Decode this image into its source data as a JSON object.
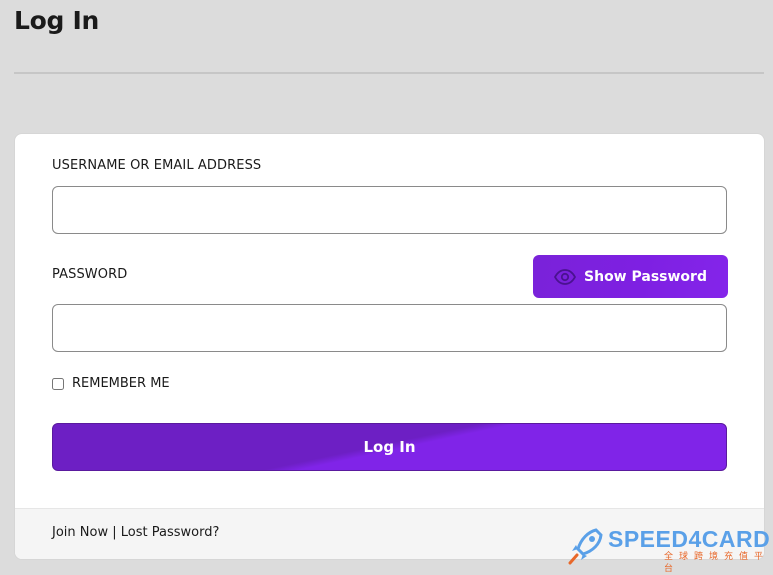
{
  "page": {
    "title": "Log In"
  },
  "form": {
    "username_label": "USERNAME OR EMAIL ADDRESS",
    "username_value": "",
    "password_label": "PASSWORD",
    "password_value": "",
    "show_password_label": "Show Password",
    "remember_label": "REMEMBER ME",
    "remember_checked": false,
    "submit_label": "Log In"
  },
  "footer": {
    "join_label": "Join Now",
    "separator": "|",
    "lost_password_label": "Lost Password?"
  },
  "watermark": {
    "brand": "SPEED4CARD",
    "tagline": "全球跨境充值平台"
  },
  "colors": {
    "accent": "#7e20e2",
    "accent_dark": "#6d1fc4",
    "page_bg": "#dcdcdc",
    "card_bg": "#ffffff"
  },
  "icons": {
    "show_password": "eye-icon",
    "watermark_logo": "rocket-icon"
  }
}
